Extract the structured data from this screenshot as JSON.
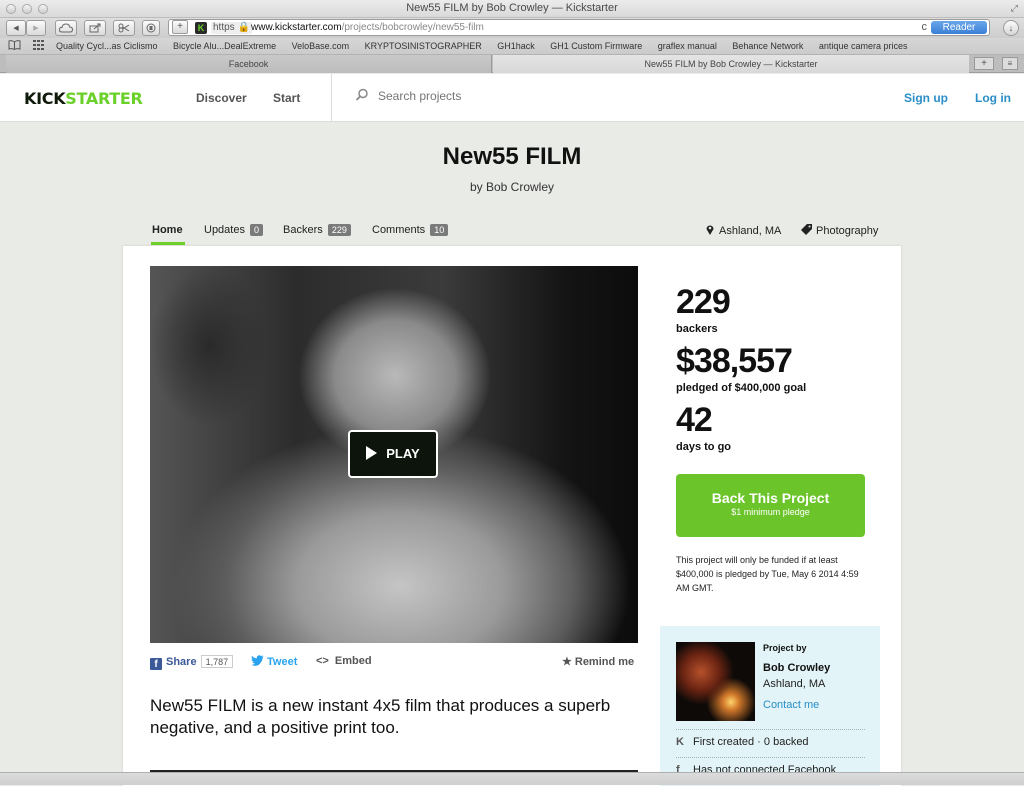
{
  "window": {
    "title": "New55 FILM by Bob Crowley — Kickstarter"
  },
  "toolbar": {
    "back_icon": "◀",
    "forward_icon": "▶",
    "add_icon": "+",
    "https_label": "https 🔒",
    "url_host": "www.kickstarter.com",
    "url_path": "/projects/bobcrowley/new55-film",
    "reload_icon": "c",
    "reader_label": "Reader"
  },
  "bookmarks": {
    "items": [
      "Quality Cycl...as Ciclismo",
      "Bicycle Alu...DealExtreme",
      "VeloBase.com",
      "KRYPTOSINISTOGRAPHER",
      "GH1hack",
      "GH1 Custom Firmware",
      "graflex manual",
      "Behance Network",
      "antique camera prices"
    ]
  },
  "tabs": {
    "items": [
      {
        "label": "Facebook",
        "active": false
      },
      {
        "label": "New55 FILM by Bob Crowley — Kickstarter",
        "active": true
      }
    ],
    "new_tab_label": "+",
    "menu_label": "≡"
  },
  "header": {
    "logo_kick": "KICK",
    "logo_starter": "STARTER",
    "nav": [
      "Discover",
      "Start"
    ],
    "search_placeholder": "Search projects",
    "signup": "Sign up",
    "login": "Log in"
  },
  "project": {
    "title": "New55 FILM",
    "byline": "by Bob Crowley",
    "subnav": {
      "home": "Home",
      "updates": "Updates",
      "updates_count": "0",
      "backers": "Backers",
      "backers_count": "229",
      "comments": "Comments",
      "comments_count": "10"
    },
    "location": "Ashland, MA",
    "category": "Photography",
    "play_label": "PLAY",
    "share": {
      "share_label": "Share",
      "share_count": "1,787",
      "tweet_label": "Tweet",
      "embed_label": "Embed",
      "remind_label": "Remind me"
    },
    "blurb": "New55 FILM is a new instant 4x5 film that produces a superb negative, and a positive print too."
  },
  "stats": {
    "backers_value": "229",
    "backers_label": "backers",
    "pledged_value": "$38,557",
    "pledged_label": "pledged of $400,000 goal",
    "days_value": "42",
    "days_label": "days to go"
  },
  "back_button": {
    "label": "Back This Project",
    "sub_label": "$1 minimum pledge"
  },
  "funding_note": "This project will only be funded if at least $400,000 is pledged by Tue, May 6 2014 4:59 AM GMT.",
  "creator": {
    "section_label": "Project by",
    "name": "Bob Crowley",
    "location": "Ashland, MA",
    "contact": "Contact me",
    "first_created": "First created · 0 backed",
    "facebook": "Has not connected Facebook"
  },
  "colors": {
    "brand_green": "#6bd12a",
    "button_green": "#6bc429",
    "link_blue": "#2a8ec7",
    "creator_box": "#e2f4f7"
  }
}
